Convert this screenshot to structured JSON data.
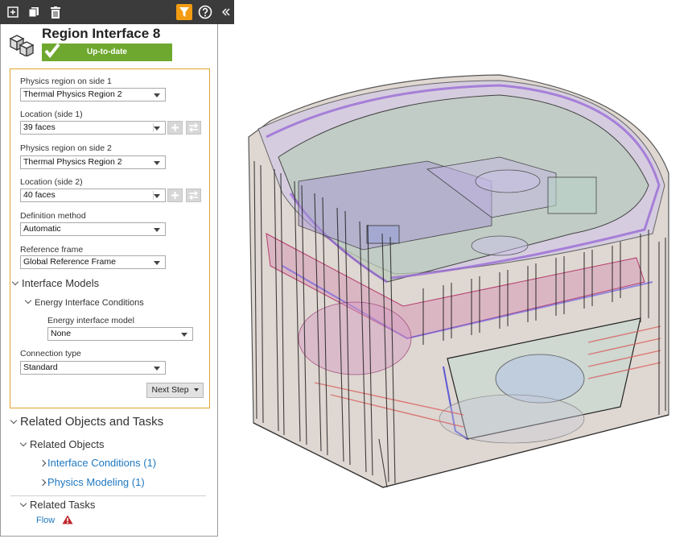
{
  "toolbar": {
    "icons": [
      "new-icon",
      "copy-icon",
      "trash-icon",
      "filter-icon",
      "help-icon",
      "collapse-icon"
    ],
    "colors": {
      "background": "#3b3b3b",
      "filter_active": "#f39c12"
    }
  },
  "header": {
    "title": "Region Interface 8",
    "status": "Up-to-date",
    "status_color": "#6ea82f"
  },
  "form": {
    "physics_region_1": {
      "label": "Physics region on side 1",
      "value": "Thermal Physics Region 2"
    },
    "location_1": {
      "label": "Location (side 1)",
      "value": "39 faces"
    },
    "physics_region_2": {
      "label": "Physics region on side 2",
      "value": "Thermal Physics Region 2"
    },
    "location_2": {
      "label": "Location (side 2)",
      "value": "40 faces"
    },
    "definition_method": {
      "label": "Definition method",
      "value": "Automatic"
    },
    "reference_frame": {
      "label": "Reference frame",
      "value": "Global Reference Frame"
    },
    "interface_models": {
      "title": "Interface Models",
      "energy": {
        "title": "Energy Interface Conditions",
        "model_label": "Energy interface model",
        "model_value": "None"
      }
    },
    "connection_type": {
      "label": "Connection type",
      "value": "Standard"
    },
    "next_step": "Next Step"
  },
  "related": {
    "title": "Related Objects and Tasks",
    "objects_title": "Related Objects",
    "objects": [
      "Interface Conditions (1)",
      "Physics Modeling (1)"
    ],
    "tasks_title": "Related Tasks",
    "tasks": [
      "Flow"
    ]
  }
}
